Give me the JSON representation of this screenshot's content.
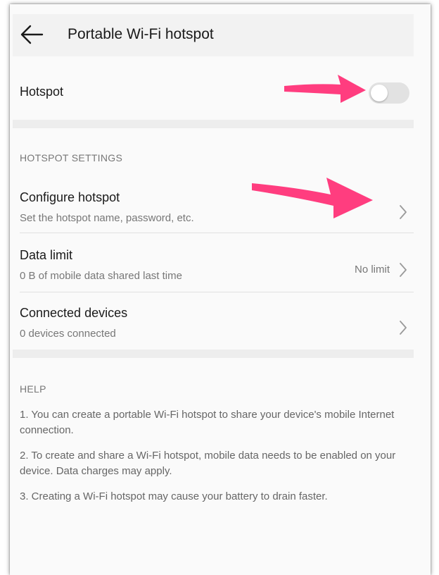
{
  "header": {
    "title": "Portable Wi-Fi hotspot",
    "back_icon": "arrow-left-icon"
  },
  "hotspot": {
    "label": "Hotspot",
    "enabled": false
  },
  "settings": {
    "header": "HOTSPOT SETTINGS",
    "items": [
      {
        "title": "Configure hotspot",
        "subtitle": "Set the hotspot name, password, etc.",
        "value": ""
      },
      {
        "title": "Data limit",
        "subtitle": "0 B of mobile data shared last time",
        "value": "No limit"
      },
      {
        "title": "Connected devices",
        "subtitle": "0 devices connected",
        "value": ""
      }
    ]
  },
  "help": {
    "header": "HELP",
    "items": [
      "1. You can create a portable Wi-Fi hotspot to share your device's mobile Internet connection.",
      "2. To create and share a Wi-Fi hotspot, mobile data needs to be enabled on your device. Data charges may apply.",
      "3. Creating a Wi-Fi hotspot may cause your battery to drain faster."
    ]
  },
  "colors": {
    "annotation_arrow": "#ff3d7f",
    "toggle_off": "#e2e2e2",
    "band": "#ededed"
  }
}
